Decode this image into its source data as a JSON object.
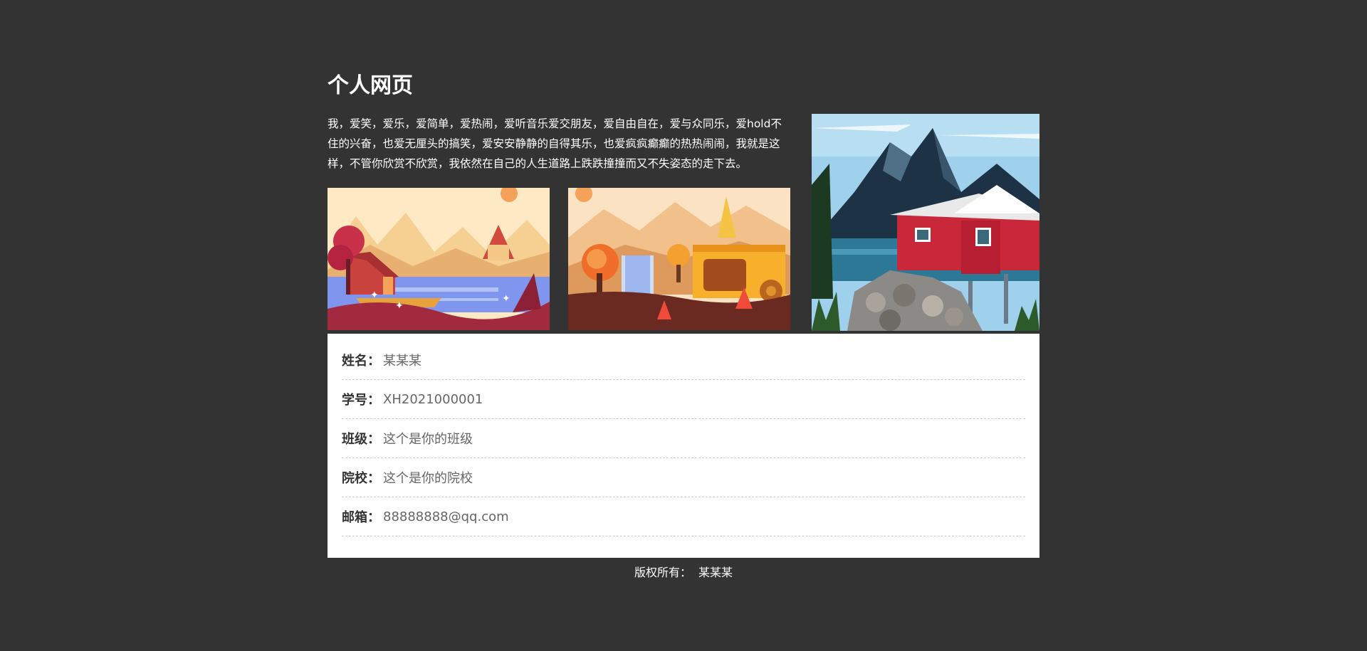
{
  "page": {
    "title": "个人网页",
    "intro": "我，爱笑，爱乐，爱简单，爱热闹，爱听音乐爱交朋友，爱自由自在，爱与众同乐，爱hold不住的兴奋，也爱无厘头的搞笑，爱安安静静的自得其乐，也爱疯疯癫癫的热热闹闹，我就是这样，不管你欣赏不欣赏，我依然在自己的人生道路上跌跌撞撞而又不失姿态的走下去。"
  },
  "images": {
    "left": "autumn-lakeside-cabin-illustration",
    "middle": "autumn-waterfall-wagon-illustration",
    "right": "red-house-mountain-lake-illustration"
  },
  "info": {
    "rows": [
      {
        "label": "姓名：",
        "value": "某某某"
      },
      {
        "label": "学号：",
        "value": "XH2021000001"
      },
      {
        "label": "班级：",
        "value": "这个是你的班级"
      },
      {
        "label": "院校：",
        "value": "这个是你的院校"
      },
      {
        "label": "邮箱：",
        "value": "88888888@qq.com"
      }
    ]
  },
  "footer": {
    "label": "版权所有：",
    "owner": "某某某"
  },
  "colors": {
    "background": "#333333",
    "card": "#ffffff",
    "text": "#ffffff"
  }
}
